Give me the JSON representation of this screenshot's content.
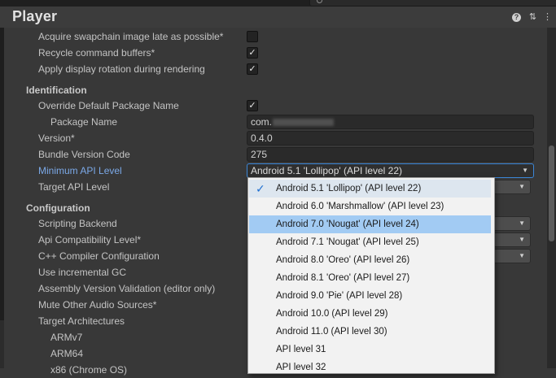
{
  "window": {
    "title": "Player"
  },
  "header_icons": [
    "help-icon",
    "presets-icon",
    "more-icon"
  ],
  "rows": [
    {
      "label": "Acquire swapchain image late as possible*",
      "checked": false
    },
    {
      "label": "Recycle command buffers*",
      "checked": true
    },
    {
      "label": "Apply display rotation during rendering",
      "checked": true
    }
  ],
  "identification": {
    "header": "Identification",
    "override_label": "Override Default Package Name",
    "package_label": "Package Name",
    "package_value": "com.",
    "version_label": "Version*",
    "version_value": "0.4.0",
    "bundle_label": "Bundle Version Code",
    "bundle_value": "275",
    "min_api_label": "Minimum API Level",
    "min_api_value": "Android 5.1 'Lollipop' (API level 22)",
    "target_api_label": "Target API Level"
  },
  "configuration": {
    "header": "Configuration",
    "labels": [
      "Scripting Backend",
      "Api Compatibility Level*",
      "C++ Compiler Configuration",
      "Use incremental GC",
      "Assembly Version Validation (editor only)",
      "Mute Other Audio Sources*",
      "Target Architectures",
      "ARMv7",
      "ARM64",
      "x86 (Chrome OS)"
    ]
  },
  "api_menu": {
    "checked_index": 0,
    "selected_index": 2,
    "items": [
      "Android 5.1 'Lollipop' (API level 22)",
      "Android 6.0 'Marshmallow' (API level 23)",
      "Android 7.0 'Nougat' (API level 24)",
      "Android 7.1 'Nougat' (API level 25)",
      "Android 8.0 'Oreo' (API level 26)",
      "Android 8.1 'Oreo' (API level 27)",
      "Android 9.0 'Pie' (API level 28)",
      "Android 10.0 (API level 29)",
      "Android 11.0 (API level 30)",
      "API level 31",
      "API level 32"
    ]
  },
  "colors": {
    "accent": "#3b87d8",
    "selection": "#a2cbf3",
    "label_active": "#7ba9e8"
  }
}
